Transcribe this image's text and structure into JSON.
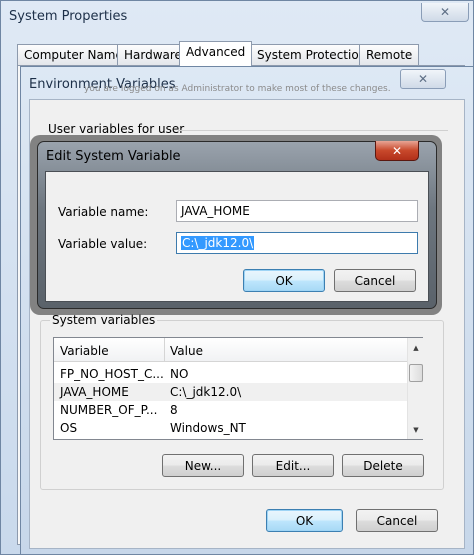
{
  "system_properties": {
    "title": "System Properties",
    "close_glyph": "✕",
    "tabs": [
      {
        "label": "Computer Name"
      },
      {
        "label": "Hardware"
      },
      {
        "label": "Advanced"
      },
      {
        "label": "System Protection"
      },
      {
        "label": "Remote"
      }
    ],
    "active_tab": "Advanced"
  },
  "environment_variables": {
    "title": "Environment Variables",
    "close_glyph": "✕",
    "obscured_text": "you are logged on as Administrator to make most of these changes.",
    "user_group_label": "User variables for user",
    "system_group_label": "System variables",
    "columns": {
      "variable": "Variable",
      "value": "Value"
    },
    "rows": [
      {
        "variable": "FP_NO_HOST_C...",
        "value": "NO"
      },
      {
        "variable": "JAVA_HOME",
        "value": "C:\\_jdk12.0\\"
      },
      {
        "variable": "NUMBER_OF_P...",
        "value": "8"
      },
      {
        "variable": "OS",
        "value": "Windows_NT"
      }
    ],
    "selected_row": 1,
    "buttons": {
      "new": "New...",
      "edit": "Edit...",
      "delete": "Delete"
    },
    "ok": "OK",
    "cancel": "Cancel"
  },
  "edit_dialog": {
    "title": "Edit System Variable",
    "close_glyph": "✕",
    "name_label": "Variable name:",
    "name_value": "JAVA_HOME",
    "value_label": "Variable value:",
    "value_value": "C:\\_jdk12.0\\",
    "ok": "OK",
    "cancel": "Cancel"
  }
}
